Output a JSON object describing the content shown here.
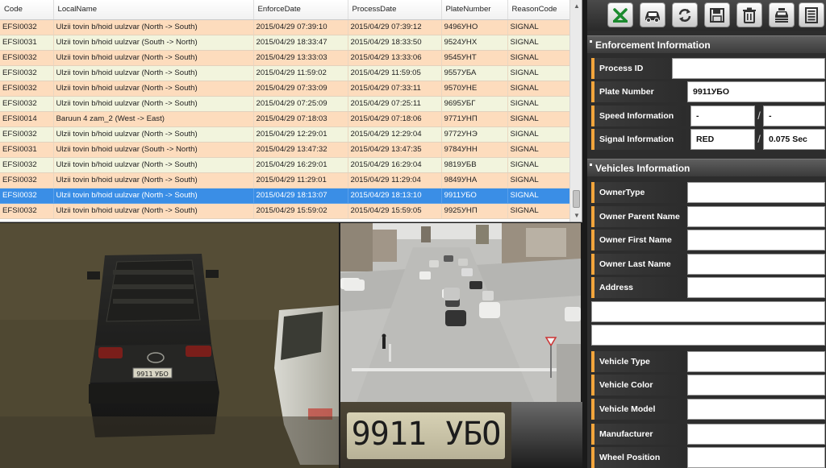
{
  "table": {
    "columns": [
      "Code",
      "LocalName",
      "EnforceDate",
      "ProcessDate",
      "PlateNumber",
      "ReasonCode"
    ],
    "rows": [
      [
        "EFSI0032",
        "Ulzii tovin b/hoid uulzvar (North -> South)",
        "2015/04/29 07:39:10",
        "2015/04/29 07:39:12",
        "9496УНО",
        "SIGNAL"
      ],
      [
        "EFSI0031",
        "Ulzii tovin b/hoid uulzvar (South -> North)",
        "2015/04/29 18:33:47",
        "2015/04/29 18:33:50",
        "9524УНХ",
        "SIGNAL"
      ],
      [
        "EFSI0032",
        "Ulzii tovin b/hoid uulzvar (North -> South)",
        "2015/04/29 13:33:03",
        "2015/04/29 13:33:06",
        "9545УНТ",
        "SIGNAL"
      ],
      [
        "EFSI0032",
        "Ulzii tovin b/hoid uulzvar (North -> South)",
        "2015/04/29 11:59:02",
        "2015/04/29 11:59:05",
        "9557УБА",
        "SIGNAL"
      ],
      [
        "EFSI0032",
        "Ulzii tovin b/hoid uulzvar (North -> South)",
        "2015/04/29 07:33:09",
        "2015/04/29 07:33:11",
        "9570УНЕ",
        "SIGNAL"
      ],
      [
        "EFSI0032",
        "Ulzii tovin b/hoid uulzvar (North -> South)",
        "2015/04/29 07:25:09",
        "2015/04/29 07:25:11",
        "9695УБГ",
        "SIGNAL"
      ],
      [
        "EFSI0014",
        "Baruun 4 zam_2 (West -> East)",
        "2015/04/29 07:18:03",
        "2015/04/29 07:18:06",
        "9771УНП",
        "SIGNAL"
      ],
      [
        "EFSI0032",
        "Ulzii tovin b/hoid uulzvar (North -> South)",
        "2015/04/29 12:29:01",
        "2015/04/29 12:29:04",
        "9772УНЭ",
        "SIGNAL"
      ],
      [
        "EFSI0031",
        "Ulzii tovin b/hoid uulzvar (South -> North)",
        "2015/04/29 13:47:32",
        "2015/04/29 13:47:35",
        "9784УНН",
        "SIGNAL"
      ],
      [
        "EFSI0032",
        "Ulzii tovin b/hoid uulzvar (North -> South)",
        "2015/04/29 16:29:01",
        "2015/04/29 16:29:04",
        "9819УБВ",
        "SIGNAL"
      ],
      [
        "EFSI0032",
        "Ulzii tovin b/hoid uulzvar (North -> South)",
        "2015/04/29 11:29:01",
        "2015/04/29 11:29:04",
        "9849УНА",
        "SIGNAL"
      ],
      [
        "EFSI0032",
        "Ulzii tovin b/hoid uulzvar (North -> South)",
        "2015/04/29 18:13:07",
        "2015/04/29 18:13:10",
        "9911УБО",
        "SIGNAL"
      ],
      [
        "EFSI0032",
        "Ulzii tovin b/hoid uulzvar (North -> South)",
        "2015/04/29 15:59:02",
        "2015/04/29 15:59:05",
        "9925УНП",
        "SIGNAL"
      ]
    ],
    "selected_row": 11
  },
  "images": {
    "car_plate_text": "9911 УБО",
    "plate_crop_text": "9911 УБО"
  },
  "toolbar": {
    "buttons": [
      "excel-export-icon",
      "car-icon",
      "refresh-icon",
      "save-icon",
      "trash-icon",
      "vehicle-print-icon",
      "list-icon"
    ]
  },
  "enforcement": {
    "title": "Enforcement Information",
    "process_id_label": "Process ID",
    "process_id_value": "",
    "plate_label": "Plate Number",
    "plate_value": "9911УБО",
    "speed_label": "Speed Information",
    "speed_value_1": "-",
    "speed_value_2": "-",
    "signal_label": "Signal Information",
    "signal_value_1": "RED",
    "signal_value_2": "0.075 Sec",
    "separator": "/"
  },
  "vehicles": {
    "title": "Vehicles Information",
    "owner_type_label": "OwnerType",
    "owner_parent_label": "Owner Parent Name",
    "owner_first_label": "Owner First Name",
    "owner_last_label": "Owner Last Name",
    "address_label": "Address",
    "vehicle_type_label": "Vehicle Type",
    "vehicle_color_label": "Vehicle Color",
    "vehicle_model_label": "Vehicle Model",
    "manufacturer_label": "Manufacturer",
    "wheel_position_label": "Wheel Position"
  },
  "colors": {
    "row_odd": "#fddcbd",
    "row_even": "#f2f4dd",
    "row_selected": "#3a8ee6",
    "label_accent": "#f2a53c"
  }
}
